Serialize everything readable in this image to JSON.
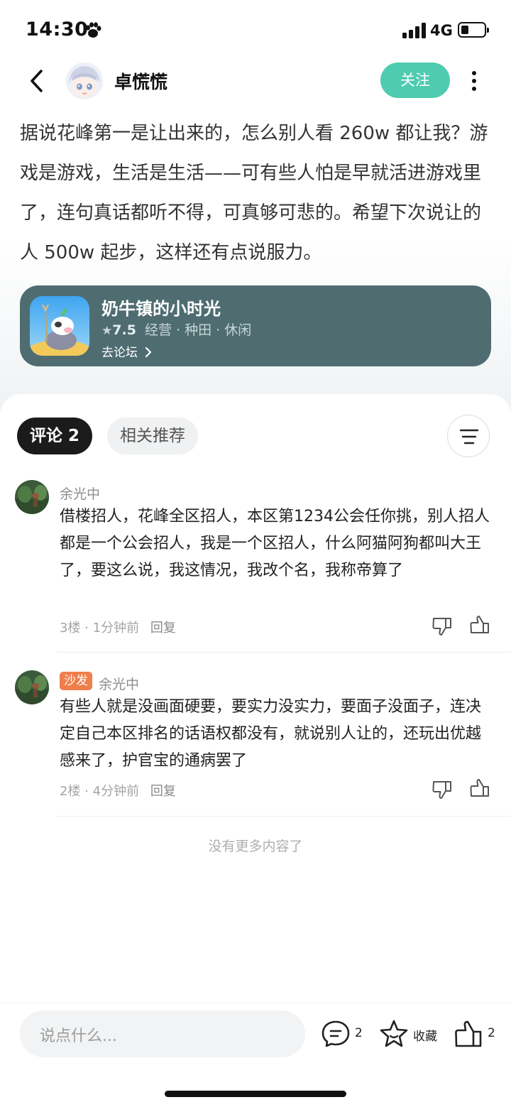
{
  "status_bar": {
    "time": "14:30",
    "network": "4G",
    "battery_level": 0.3
  },
  "header": {
    "author": "卓慌慌",
    "follow_label": "关注"
  },
  "post": {
    "body": "据说花峰第一是让出来的，怎么别人看 260w 都让我？游戏是游戏，生活是生活——可有些人怕是早就活进游戏里了，连句真话都听不得，可真够可悲的。希望下次说让的人 500w 起步，这样还有点说服力。"
  },
  "game": {
    "name": "奶牛镇的小时光",
    "rating": "7.5",
    "tags": "经营 · 种田 · 休闲",
    "link_label": "去论坛"
  },
  "tabs": {
    "comments_label": "评论",
    "comments_count": "2",
    "related_label": "相关推荐"
  },
  "comments": [
    {
      "user": "余光中",
      "text": "借楼招人，花峰全区招人，本区第1234公会任你挑，别人招人都是一个公会招人，我是一个区招人，什么阿猫阿狗都叫大王了，要这么说，我这情况，我改个名，我称帝算了",
      "floor": "3楼",
      "time": "1分钟前",
      "reply_label": "回复"
    },
    {
      "badge": "沙发",
      "user": "余光中",
      "text": "有些人就是没画面硬要，要实力没实力，要面子没面子，连决定自己本区排名的话语权都没有，就说别人让的，还玩出优越感来了，护官宝的通病罢了",
      "floor": "2楼",
      "time": "4分钟前",
      "reply_label": "回复"
    }
  ],
  "no_more": "没有更多内容了",
  "bottom_bar": {
    "placeholder": "说点什么...",
    "comment_count": "2",
    "favorite_label": "收藏",
    "like_count": "2"
  },
  "colors": {
    "accent": "#4fcbb0",
    "card_bg": "#4f6d71",
    "badge": "#ef7e4b"
  },
  "icons": [
    "back-arrow-icon",
    "more-vertical-icon",
    "star-icon",
    "chevron-right-icon",
    "sort-icon",
    "thumb-down-icon",
    "thumb-up-icon",
    "comment-bubble-icon",
    "favorite-star-icon",
    "paw-icon",
    "signal-icon",
    "battery-icon"
  ]
}
